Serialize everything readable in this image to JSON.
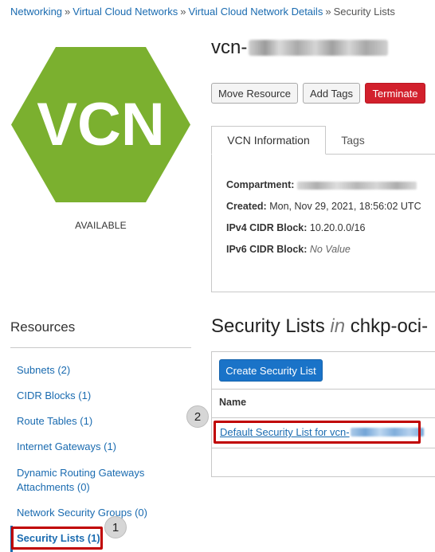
{
  "breadcrumb": {
    "items": [
      "Networking",
      "Virtual Cloud Networks",
      "Virtual Cloud Network Details"
    ],
    "current": "Security Lists",
    "separator": "»"
  },
  "vcn": {
    "logo_text": "VCN",
    "logo_color": "#7bb02f",
    "status": "AVAILABLE",
    "name_prefix": "vcn-"
  },
  "actions": {
    "move": "Move Resource",
    "tags": "Add Tags",
    "terminate": "Terminate"
  },
  "tabs": {
    "info": "VCN Information",
    "tags": "Tags"
  },
  "info": {
    "compartment_label": "Compartment:",
    "created_label": "Created:",
    "created_value": "Mon, Nov 29, 2021, 18:56:02 UTC",
    "ipv4_label": "IPv4 CIDR Block:",
    "ipv4_value": "10.20.0.0/16",
    "ipv6_label": "IPv6 CIDR Block:",
    "ipv6_value": "No Value"
  },
  "resources": {
    "title": "Resources",
    "items": [
      {
        "label": "Subnets (2)"
      },
      {
        "label": "CIDR Blocks (1)"
      },
      {
        "label": "Route Tables (1)"
      },
      {
        "label": "Internet Gateways (1)"
      },
      {
        "label": "Dynamic Routing Gateways Attachments (0)"
      },
      {
        "label": "Network Security Groups (0)"
      },
      {
        "label": "Security Lists (1)"
      }
    ]
  },
  "security_lists": {
    "title": "Security Lists",
    "in": "in",
    "compartment": "chkp-oci-",
    "create_button": "Create Security List",
    "column_name": "Name",
    "rows": [
      {
        "name_prefix": "Default Security List for vcn-"
      }
    ]
  },
  "callouts": [
    "1",
    "2"
  ],
  "colors": {
    "link": "#1a6bb0",
    "primary": "#1a73c8",
    "danger": "#d2202c",
    "highlight": "#c00000"
  }
}
